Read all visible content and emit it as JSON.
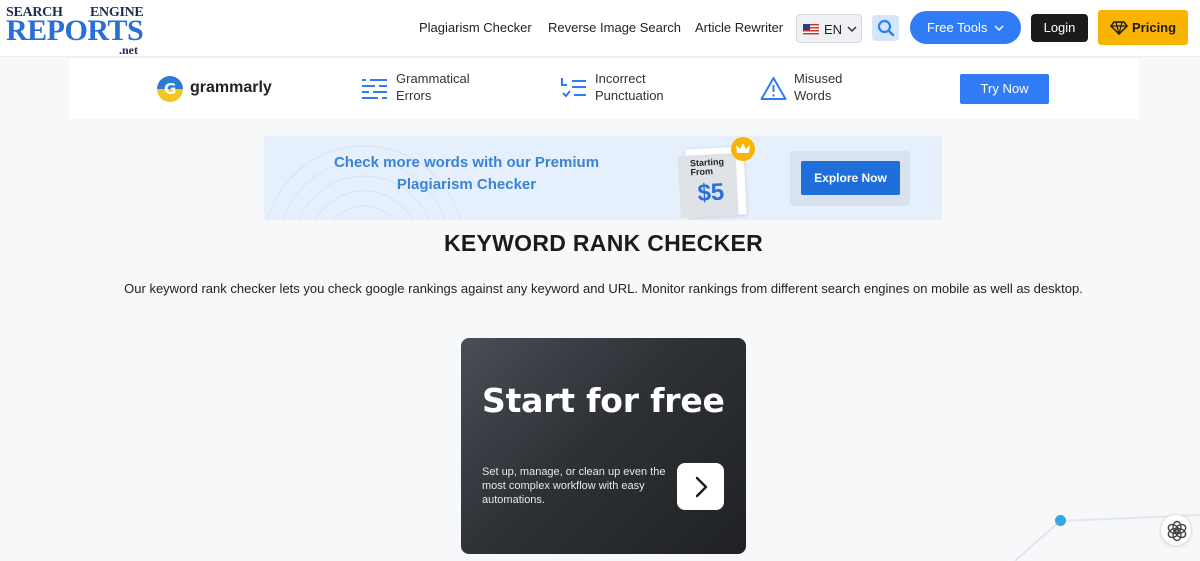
{
  "header": {
    "logo": {
      "top_left": "SEARCH",
      "top_right": "ENGINE",
      "main": "REPORTS",
      "suffix": ".net"
    },
    "nav": [
      {
        "label": "Plagiarism Checker"
      },
      {
        "label": "Reverse Image Search"
      },
      {
        "label": "Article Rewriter"
      }
    ],
    "language": {
      "selected": "EN",
      "flag_icon": "us-flag-icon"
    },
    "search_icon": "search-icon",
    "free_tools_label": "Free Tools",
    "login_label": "Login",
    "pricing_label": "Pricing"
  },
  "grammarly": {
    "brand": "grammarly",
    "features": [
      {
        "line1": "Grammatical",
        "line2": "Errors",
        "icon": "lines-icon"
      },
      {
        "line1": "Incorrect",
        "line2": "Punctuation",
        "icon": "checklist-icon"
      },
      {
        "line1": "Misused",
        "line2": "Words",
        "icon": "warning-icon"
      }
    ],
    "cta_label": "Try Now"
  },
  "premium_banner": {
    "headline_line1": "Check more words with our Premium",
    "headline_line2": "Plagiarism Checker",
    "starting_line1": "Starting",
    "starting_line2": "From",
    "price": "$5",
    "cta_label": "Explore Now"
  },
  "main": {
    "title": "KEYWORD RANK CHECKER",
    "description": "Our keyword rank checker lets you check google rankings against any keyword and URL. Monitor rankings from different search engines on mobile as well as desktop."
  },
  "ad": {
    "title": "Start for free",
    "text": "Set up, manage, or clean up even the most complex workflow with easy automations."
  },
  "colors": {
    "primary_blue": "#2f7cf6",
    "pricing_yellow": "#f8b400",
    "login_black": "#1b1b1b",
    "banner_bg": "#e6f0fc"
  }
}
